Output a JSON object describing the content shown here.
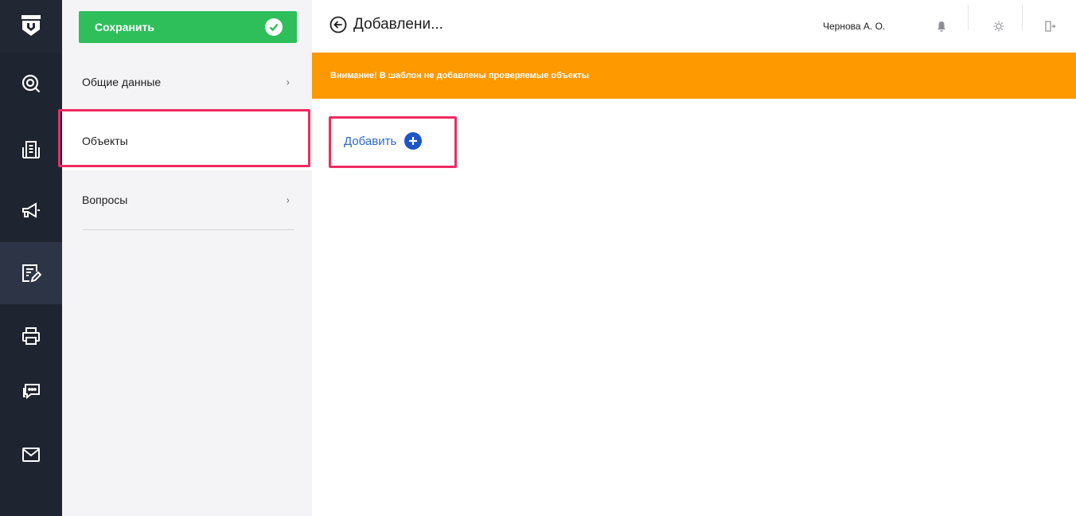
{
  "toolbar": {
    "save_label": "Сохранить"
  },
  "side_menu": {
    "items": [
      {
        "label": "Общие данные",
        "chevron": "›",
        "selected": false
      },
      {
        "label": "Объекты",
        "chevron": "",
        "selected": true
      },
      {
        "label": "Вопросы",
        "chevron": "›",
        "selected": false
      }
    ]
  },
  "header": {
    "title": "Добавлени...",
    "user": "Чернова А. О."
  },
  "warning": {
    "text": "Внимание! В шаблон не добавлены проверяемые объекты"
  },
  "main": {
    "add_label": "Добавить"
  },
  "rail_icons": [
    "logo-shield-icon",
    "search-icon",
    "building-icon",
    "megaphone-icon",
    "checklist-edit-icon",
    "printer-icon",
    "chat-icon",
    "mail-icon"
  ],
  "header_icons": [
    "bell-icon",
    "gear-icon",
    "logout-icon"
  ],
  "colors": {
    "rail_bg": "#1f2431",
    "side_bg": "#f4f4f6",
    "save_green": "#2ebf5b",
    "warning_orange": "#ff9900",
    "link_blue": "#2e68c9",
    "highlight_pink": "#ef2b62"
  }
}
